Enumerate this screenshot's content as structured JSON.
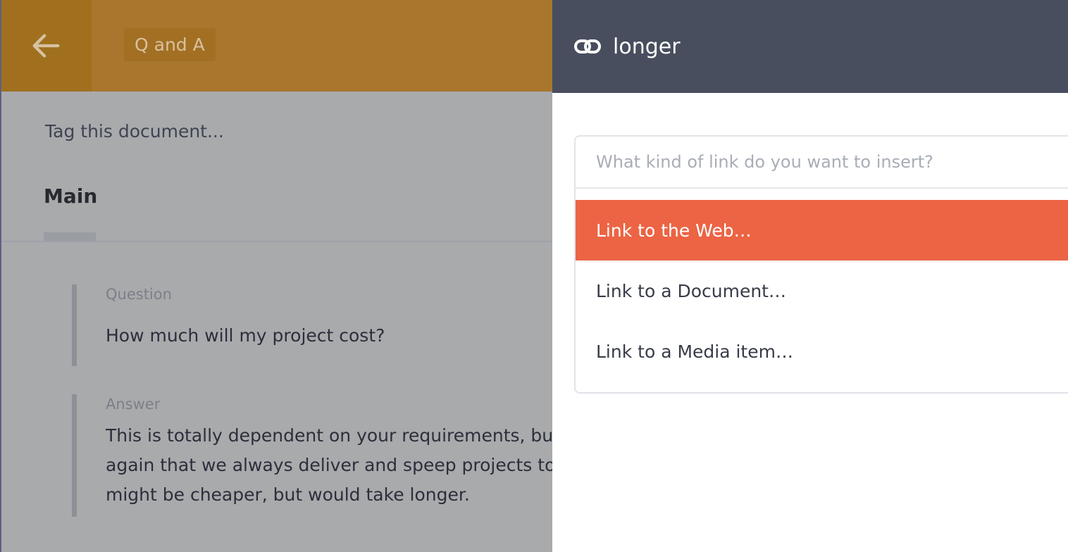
{
  "editor": {
    "title": "Q and A",
    "tag_prompt": "Tag this document...",
    "tab_main": "Main",
    "question": {
      "label": "Question",
      "text": "How much will my project cost?"
    },
    "answer": {
      "label": "Answer",
      "line1": "This is totally dependent on your requirements, but F",
      "line2": "again that we always deliver and speep projects to m",
      "line3": "might be cheaper, but would take longer."
    }
  },
  "link_panel": {
    "title": "longer",
    "search_placeholder": "What kind of link do you want to insert?",
    "options": [
      {
        "label": "Link to the Web…",
        "active": true
      },
      {
        "label": "Link to a Document…",
        "active": false
      },
      {
        "label": "Link to a Media item…",
        "active": false
      }
    ]
  },
  "colors": {
    "topbar": "#a8772d",
    "panel_header": "#484e5e",
    "accent": "#ec6444",
    "overlay_bg": "#a9aaac"
  },
  "icons": {
    "back": "arrow-left-icon",
    "link": "link-icon"
  }
}
